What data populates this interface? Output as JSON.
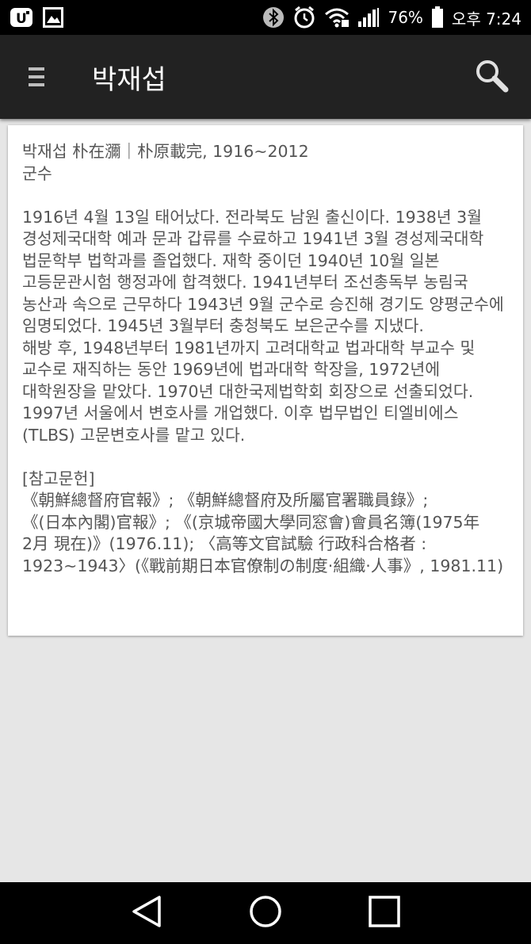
{
  "status_bar": {
    "left_icons": [
      "carrier-logo-icon",
      "gallery-icon"
    ],
    "right_icons": [
      "bluetooth-icon",
      "alarm-icon",
      "wifi-icon",
      "signal-icon",
      "battery-icon"
    ],
    "battery": "76%",
    "time": "오후 7:24"
  },
  "app_bar": {
    "title": "박재섭",
    "menu_icon": "menu-icon",
    "search_icon": "search-icon"
  },
  "article": {
    "heading": "박재섭 朴在瀰｜朴原載完, 1916~2012\n군수",
    "body": "1916년 4월 13일 태어났다. 전라북도 남원 출신이다. 1938년 3월 경성제국대학 예과 문과 갑류를 수료하고 1941년 3월 경성제국대학 법문학부 법학과를 졸업했다. 재학 중이던 1940년 10월 일본 고등문관시험 행정과에 합격했다. 1941년부터 조선총독부 농림국 농산과 속으로 근무하다 1943년 9월 군수로 승진해 경기도 양평군수에 임명되었다. 1945년 3월부터 충청북도 보은군수를 지냈다.\n해방 후, 1948년부터 1981년까지 고려대학교 법과대학 부교수 및 교수로 재직하는 동안 1969년에 법과대학 학장을, 1972년에 대학원장을 맡았다. 1970년 대한국제법학회 회장으로 선출되었다. 1997년 서울에서 변호사를 개업했다. 이후 법무법인 티엘비에스(TLBS) 고문변호사를 맡고 있다.",
    "references_label": "[참고문헌]",
    "references": "《朝鮮總督府官報》; 《朝鮮總督府及所屬官署職員錄》; 《(日本內閣)官報》; 《(京城帝國大學同窓會)會員名簿(1975年 2月 現在)》(1976.11); 〈高等文官試驗 行政科合格者 : 1923~1943〉(《戰前期日本官僚制の制度·組織·人事》, 1981.11)"
  },
  "nav_bar": {
    "back_icon": "back-triangle-icon",
    "home_icon": "home-circle-icon",
    "recents_icon": "recents-square-icon"
  }
}
